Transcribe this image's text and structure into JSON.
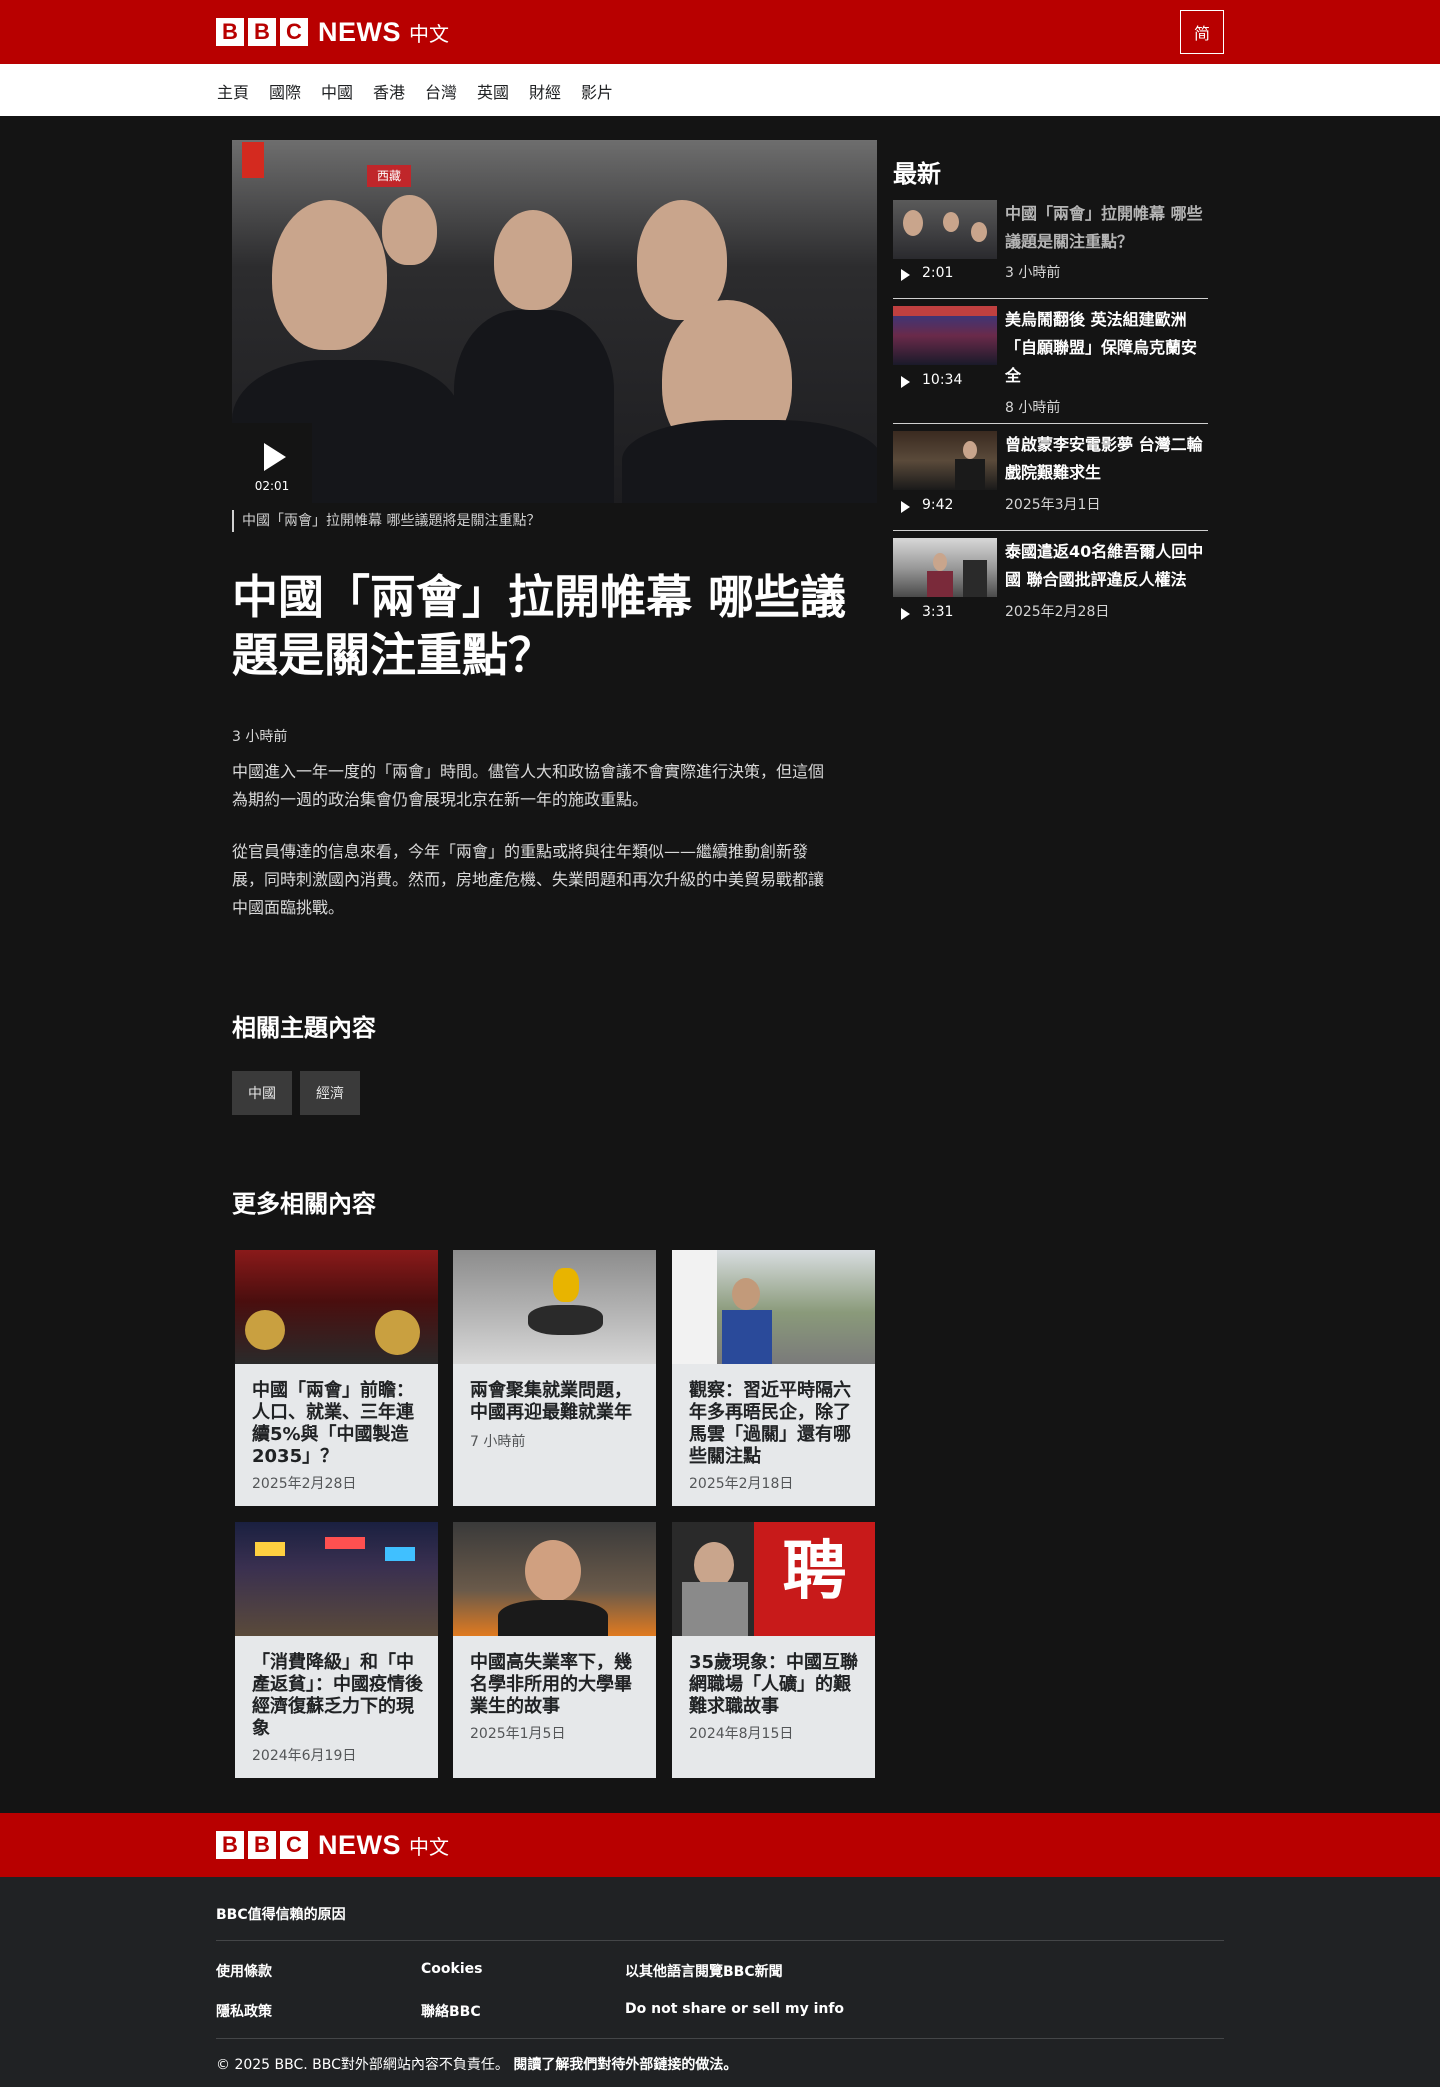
{
  "brand": {
    "letters": [
      "B",
      "B",
      "C"
    ],
    "news": "NEWS",
    "lang": "中文"
  },
  "header": {
    "lang_toggle": "简"
  },
  "nav": [
    "主頁",
    "國際",
    "中國",
    "香港",
    "台灣",
    "英國",
    "財經",
    "影片"
  ],
  "hero": {
    "video_duration": "02:01",
    "caption": "中國「兩會」拉開帷幕 哪些議題將是關注重點？",
    "sign_text": "西藏"
  },
  "article": {
    "headline": "中國「兩會」拉開帷幕 哪些議題是關注重點？",
    "timestamp": "3 小時前",
    "paragraphs": [
      "中國進入一年一度的「兩會」時間。儘管人大和政協會議不會實際進行決策，但這個為期約一週的政治集會仍會展現北京在新一年的施政重點。",
      "從官員傳達的信息來看，今年「兩會」的重點或將與往年類似——繼續推動創新發展，同時刺激國內消費。然而，房地產危機、失業問題和再次升級的中美貿易戰都讓中國面臨挑戰。"
    ]
  },
  "topics": {
    "title": "相關主題內容",
    "tags": [
      "中國",
      "經濟"
    ]
  },
  "related": {
    "title": "更多相關內容",
    "cards": [
      {
        "title": "中國「兩會」前瞻：人口、就業、三年連續5%與「中國製造2035」？",
        "date": "2025年2月28日"
      },
      {
        "title": "兩會聚集就業問題，中國再迎最難就業年",
        "date": "7 小時前"
      },
      {
        "title": "觀察：習近平時隔六年多再晤民企，除了馬雲「過關」還有哪些關注點",
        "date": "2025年2月18日"
      },
      {
        "title": "「消費降級」和「中產返貧」：中國疫情後經濟復蘇乏力下的現象",
        "date": "2024年6月19日"
      },
      {
        "title": "中國高失業率下，幾名學非所用的大學畢業生的故事",
        "date": "2025年1月5日"
      },
      {
        "title": "35歲現象：中國互聯網職場「人礦」的艱難求職故事",
        "date": "2024年8月15日",
        "sign": "聘"
      }
    ]
  },
  "sidebar": {
    "title": "最新",
    "items": [
      {
        "headline": "中國「兩會」拉開帷幕 哪些議題是關注重點？",
        "duration": "2:01",
        "date": "3 小時前"
      },
      {
        "headline": "美烏鬧翻後 英法組建歐洲「自願聯盟」保障烏克蘭安全",
        "duration": "10:34",
        "date": "8 小時前"
      },
      {
        "headline": "曾啟蒙李安電影夢 台灣二輪戲院艱難求生",
        "duration": "9:42",
        "date": "2025年3月1日"
      },
      {
        "headline": "泰國遣返40名維吾爾人回中國 聯合國批評違反人權法",
        "duration": "3:31",
        "date": "2025年2月28日"
      }
    ]
  },
  "footer": {
    "trust": "BBC值得信賴的原因",
    "links": [
      "使用條款",
      "Cookies",
      "以其他語言閱覽BBC新聞",
      "隱私政策",
      "聯絡BBC",
      "Do not share or sell my info"
    ],
    "copyright": "© 2025 BBC. BBC對外部網站內容不負責任。",
    "external_link": "閱讀了解我們對待外部鏈接的做法。"
  },
  "colors": {
    "brand_red": "#b80000",
    "background": "#141414",
    "footer_bg": "#202224",
    "card_bg": "#e6e8ea"
  }
}
